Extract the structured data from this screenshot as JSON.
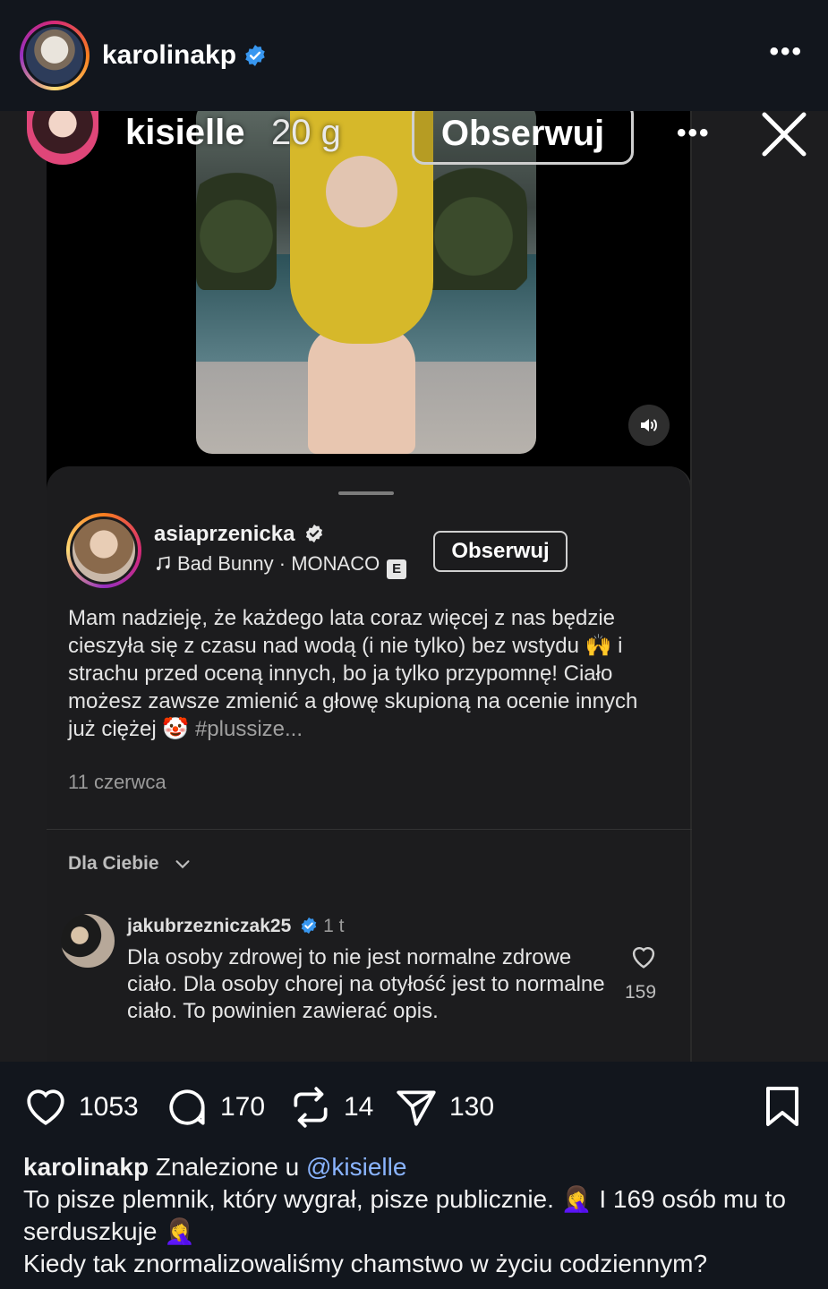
{
  "header": {
    "username": "karolinakp",
    "verified": true
  },
  "story": {
    "username": "kisielle",
    "time": "20 g",
    "follow_label": "Obserwuj"
  },
  "post": {
    "username": "asiaprzenicka",
    "music": "Bad Bunny · MONACO",
    "explicit_badge": "E",
    "follow_label": "Obserwuj",
    "caption_text": "Mam nadzieję, że każdego lata coraz więcej z nas będzie cieszyła się z czasu nad wodą (i nie tylko) bez wstydu 🙌 i strachu przed oceną innych, bo ja tylko przypomnę! Ciało możesz zawsze zmienić a głowę skupioną na ocenie innych już ciężej 🤡 ",
    "caption_tag": "#plussize...",
    "date": "11 czerwca"
  },
  "comments": {
    "filter_label": "Dla Ciebie",
    "items": [
      {
        "username": "jakubrzezniczak25",
        "time": "1 t",
        "text": "Dla osoby zdrowej to nie jest normalne zdrowe ciało. Dla osoby chorej na otyłość jest to normalne ciało. To powinien zawierać opis.",
        "likes": "159"
      }
    ]
  },
  "actions": {
    "likes": "1053",
    "comments": "170",
    "reposts": "14",
    "shares": "130"
  },
  "caption": {
    "username": "karolinakp",
    "intro": " Znalezione u ",
    "mention": "@kisielle",
    "line2": "To pisze plemnik, który wygrał, pisze publicznie. 🤦‍♀️ I 169 osób mu to serduszkuje 🤦‍♀️",
    "line3": "Kiedy tak znormalizowaliśmy chamstwo w życiu codziennym?"
  },
  "colors": {
    "background": "#12161d",
    "verified": "#3897f0",
    "mention": "#8ab4ff",
    "swimsuit": "#d6b82a"
  },
  "icons": [
    "more-icon",
    "verified-icon",
    "close-icon",
    "sound-icon",
    "music-note-icon",
    "chevron-down-icon",
    "heart-icon",
    "comment-icon",
    "repost-icon",
    "share-icon",
    "bookmark-icon"
  ]
}
